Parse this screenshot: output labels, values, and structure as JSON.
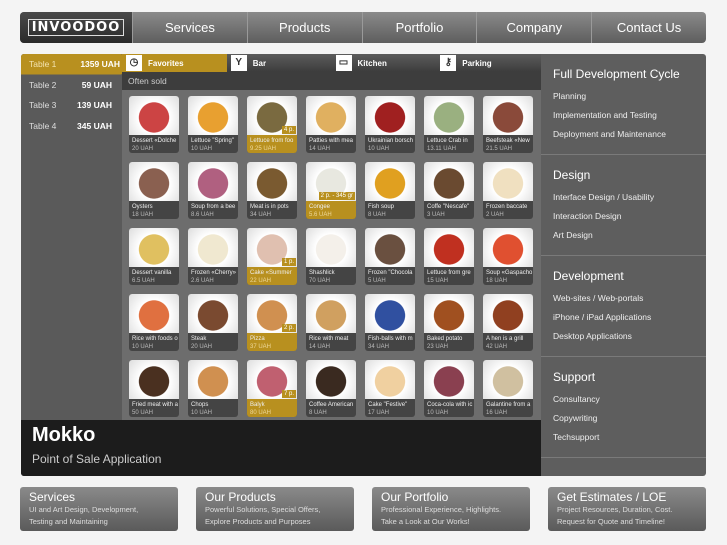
{
  "nav": {
    "logo": "INVOODOO",
    "items": [
      "Services",
      "Products",
      "Portfolio",
      "Company",
      "Contact Us"
    ]
  },
  "tables": [
    {
      "name": "Table 1",
      "amount": "1359 UAH"
    },
    {
      "name": "Table 2",
      "amount": "59 UAH"
    },
    {
      "name": "Table 3",
      "amount": "139 UAH"
    },
    {
      "name": "Table 4",
      "amount": "345 UAH"
    }
  ],
  "tabs": [
    {
      "label": "Favorites",
      "icon": "clock-icon"
    },
    {
      "label": "Bar",
      "icon": "cocktail-icon"
    },
    {
      "label": "Kitchen",
      "icon": "pot-icon"
    },
    {
      "label": "Parking",
      "icon": "keys-icon"
    }
  ],
  "section_label": "Often sold",
  "items": [
    {
      "name": "Dessert «Dolche",
      "price": "20 UAH",
      "color": "#c44"
    },
    {
      "name": "Lettuce \"Spring\"",
      "price": "10 UAH",
      "color": "#e8a030"
    },
    {
      "name": "Lettuce from foo",
      "price": "9.25 UAH",
      "color": "#7a6a40",
      "badge": "4 p."
    },
    {
      "name": "Patties with mea",
      "price": "14 UAH",
      "color": "#e0b060"
    },
    {
      "name": "Ukrainian borsch",
      "price": "10 UAH",
      "color": "#a02020"
    },
    {
      "name": "Lettuce Crab in",
      "price": "13.11 UAH",
      "color": "#9ab080"
    },
    {
      "name": "Beefsteak «New",
      "price": "21.5 UAH",
      "color": "#8a4a3a"
    },
    {
      "name": "Oysters",
      "price": "18 UAH",
      "color": "#8a6050"
    },
    {
      "name": "Soup from a bee",
      "price": "8.6 UAH",
      "color": "#b06080"
    },
    {
      "name": "Meat is in pots",
      "price": "34 UAH",
      "color": "#7a5a30"
    },
    {
      "name": "Congee",
      "price": "5.6 UAH",
      "color": "#e8e8e0",
      "badge": "2 p. - 345 gr"
    },
    {
      "name": "Fish soup",
      "price": "8 UAH",
      "color": "#e0a020"
    },
    {
      "name": "Coffe \"Nescafe\"",
      "price": "3 UAH",
      "color": "#6a4a30"
    },
    {
      "name": "Frozen baccate",
      "price": "2 UAH",
      "color": "#f0e0c0"
    },
    {
      "name": "Dessert vanilla",
      "price": "6.5 UAH",
      "color": "#e0c060"
    },
    {
      "name": "Frozen «Cherry»",
      "price": "2.6 UAH",
      "color": "#f0e8d0"
    },
    {
      "name": "Cake «Summer",
      "price": "22 UAH",
      "color": "#e0c0b0",
      "badge": "1 p."
    },
    {
      "name": "Shashlick",
      "price": "70 UAH",
      "color": "#f4f0ea"
    },
    {
      "name": "Frozen \"Chocola",
      "price": "5 UAH",
      "color": "#6a5040"
    },
    {
      "name": "Lettuce from gre",
      "price": "15 UAH",
      "color": "#c03020"
    },
    {
      "name": "Soup «Gaspacho",
      "price": "18 UAH",
      "color": "#e05030"
    },
    {
      "name": "Rice with foods o",
      "price": "10 UAH",
      "color": "#e07040"
    },
    {
      "name": "Steak",
      "price": "20 UAH",
      "color": "#7a4a30"
    },
    {
      "name": "Pizza",
      "price": "37 UAH",
      "color": "#d09050",
      "badge": "2 p."
    },
    {
      "name": "Rice with meat",
      "price": "14 UAH",
      "color": "#d0a060"
    },
    {
      "name": "Fish-balls with m",
      "price": "34 UAH",
      "color": "#3050a0"
    },
    {
      "name": "Baked potato",
      "price": "23 UAH",
      "color": "#a05020"
    },
    {
      "name": "A hen is a grill",
      "price": "42 UAH",
      "color": "#904020"
    },
    {
      "name": "Fried meat with a",
      "price": "50 UAH",
      "color": "#4a3020"
    },
    {
      "name": "Chops",
      "price": "10 UAH",
      "color": "#d09050"
    },
    {
      "name": "Balyk",
      "price": "80 UAH",
      "color": "#c06070",
      "badge": "7 p."
    },
    {
      "name": "Coffee American",
      "price": "8 UAH",
      "color": "#3a2a20"
    },
    {
      "name": "Cake \"Festive\"",
      "price": "17 UAH",
      "color": "#f0d0a0"
    },
    {
      "name": "Coca-cola with ic",
      "price": "10 UAH",
      "color": "#8a4050"
    },
    {
      "name": "Galantine from a",
      "price": "16 UAH",
      "color": "#d0c0a0"
    }
  ],
  "caption": {
    "title": "Mokko",
    "subtitle": "Point of Sale Application"
  },
  "sidebar": [
    {
      "title": "Full Development Cycle",
      "links": [
        "Planning",
        "Implementation and Testing",
        "Deployment and Maintenance"
      ]
    },
    {
      "title": "Design",
      "links": [
        "Interface Design / Usability",
        "Interaction Design",
        "Art Design"
      ]
    },
    {
      "title": "Development",
      "links": [
        "Web-sites / Web-portals",
        "iPhone / iPad Applications",
        "Desktop Applications"
      ]
    },
    {
      "title": "Support",
      "links": [
        "Consultancy",
        "Copywriting",
        "Techsupport"
      ]
    }
  ],
  "boxes": [
    {
      "title": "Services",
      "lines": [
        "UI and Art Design, Development,",
        "Testing and Maintaining"
      ]
    },
    {
      "title": "Our Products",
      "lines": [
        "Powerful Solutions, Special Offers,",
        "Explore Products and Purposes"
      ]
    },
    {
      "title": "Our Portfolio",
      "lines": [
        "Professional Experience, Highlights.",
        "Take a Look at Our Works!"
      ]
    },
    {
      "title": "Get Estimates / LOE",
      "lines": [
        "Project Resources, Duration, Cost.",
        "Request for Quote and Timeline!"
      ]
    }
  ],
  "colors": {
    "accent": "#b8901f"
  }
}
